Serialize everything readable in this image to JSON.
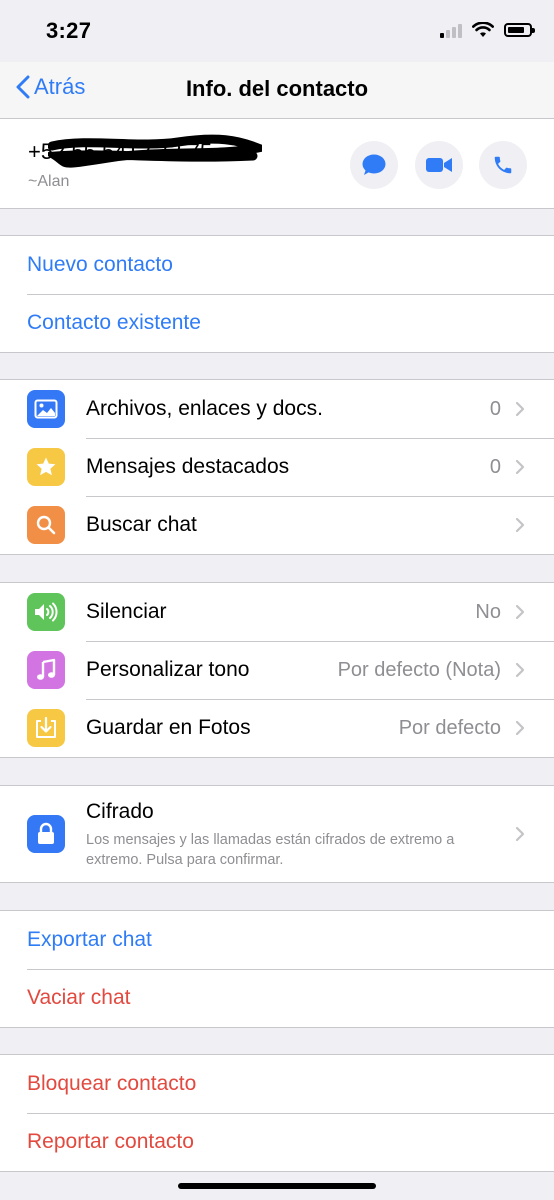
{
  "status_bar": {
    "time": "3:27"
  },
  "nav": {
    "back_label": "Atrás",
    "title": "Info. del contacto"
  },
  "contact": {
    "phone": "+52 55 5412 73 75",
    "name": "~Alan"
  },
  "add_section": {
    "new_contact": "Nuevo contacto",
    "existing_contact": "Contacto existente"
  },
  "media_section": {
    "files": {
      "label": "Archivos, enlaces y docs.",
      "value": "0",
      "icon": "photo-icon",
      "color": "#3478f6"
    },
    "starred": {
      "label": "Mensajes destacados",
      "value": "0",
      "icon": "star-icon",
      "color": "#f7c844"
    },
    "search": {
      "label": "Buscar chat",
      "icon": "search-icon",
      "color": "#f18f46"
    }
  },
  "settings_section": {
    "mute": {
      "label": "Silenciar",
      "value": "No",
      "icon": "speaker-icon",
      "color": "#5fc55a"
    },
    "tone": {
      "label": "Personalizar tono",
      "value": "Por defecto (Nota)",
      "icon": "music-note-icon",
      "color": "#d374e3"
    },
    "save": {
      "label": "Guardar en Fotos",
      "value": "Por defecto",
      "icon": "download-icon",
      "color": "#f7c844"
    }
  },
  "encryption": {
    "label": "Cifrado",
    "description": "Los mensajes y las llamadas están cifrados de extremo a extremo. Pulsa para confirmar.",
    "icon": "lock-icon",
    "color": "#3478f6"
  },
  "chat_actions": {
    "export": "Exportar chat",
    "clear": "Vaciar chat"
  },
  "contact_actions": {
    "block": "Bloquear contacto",
    "report": "Reportar contacto"
  },
  "colors": {
    "accent": "#2f7cf6",
    "destructive": "#e2493f"
  }
}
